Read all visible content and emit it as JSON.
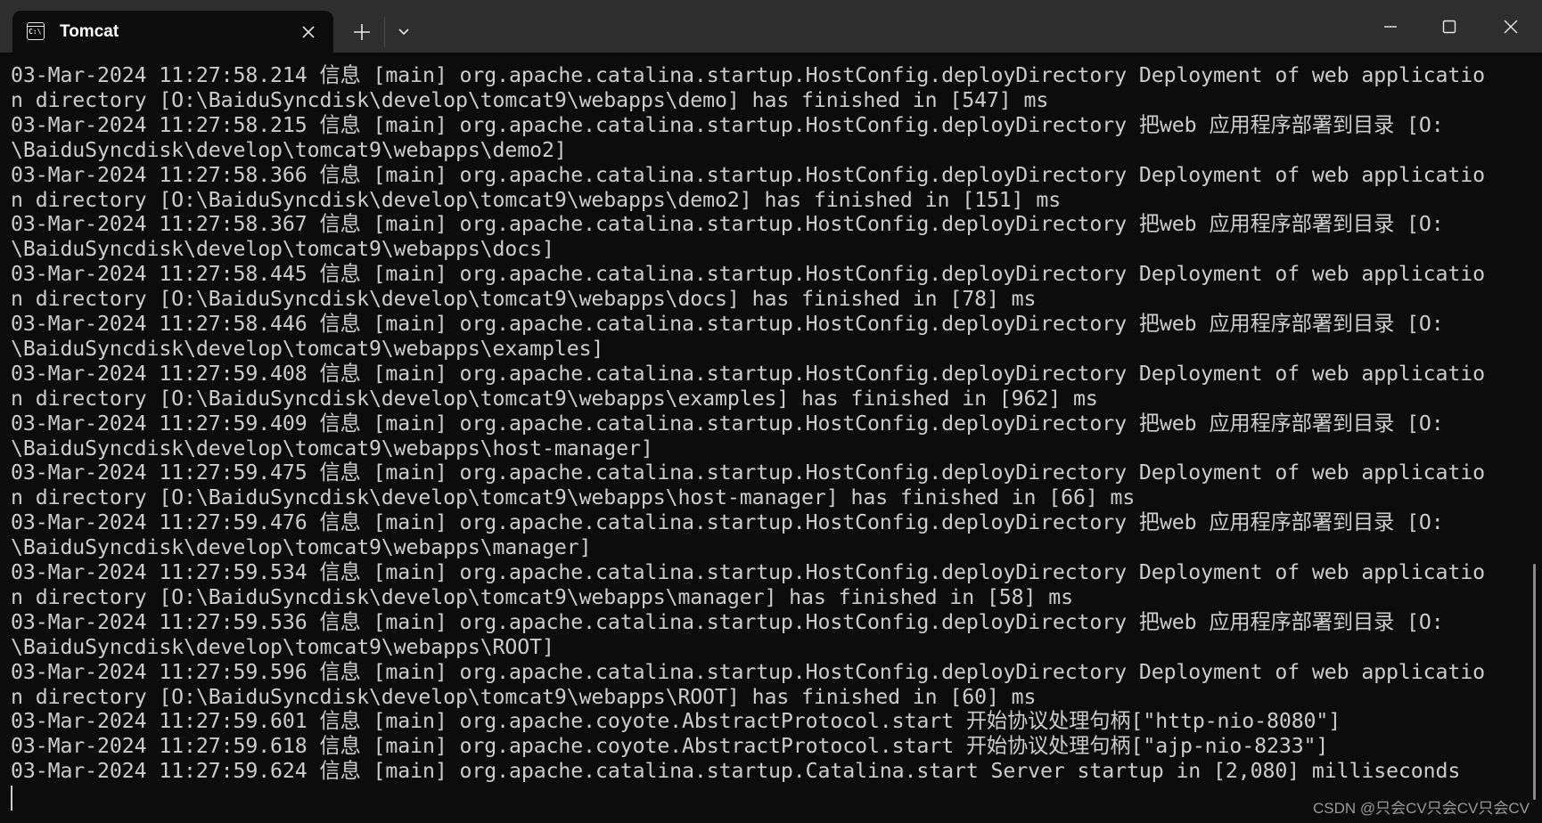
{
  "window": {
    "tab_title": "Tomcat",
    "tab_icon": "cmd-icon",
    "tab_icon_text": "C:\\",
    "new_tab_label": "+",
    "close_tab_label": "✕"
  },
  "terminal": {
    "lines": [
      "03-Mar-2024 11:27:58.214 信息 [main] org.apache.catalina.startup.HostConfig.deployDirectory Deployment of web applicatio",
      "n directory [O:\\BaiduSyncdisk\\develop\\tomcat9\\webapps\\demo] has finished in [547] ms",
      "03-Mar-2024 11:27:58.215 信息 [main] org.apache.catalina.startup.HostConfig.deployDirectory 把web 应用程序部署到目录 [O:",
      "\\BaiduSyncdisk\\develop\\tomcat9\\webapps\\demo2]",
      "03-Mar-2024 11:27:58.366 信息 [main] org.apache.catalina.startup.HostConfig.deployDirectory Deployment of web applicatio",
      "n directory [O:\\BaiduSyncdisk\\develop\\tomcat9\\webapps\\demo2] has finished in [151] ms",
      "03-Mar-2024 11:27:58.367 信息 [main] org.apache.catalina.startup.HostConfig.deployDirectory 把web 应用程序部署到目录 [O:",
      "\\BaiduSyncdisk\\develop\\tomcat9\\webapps\\docs]",
      "03-Mar-2024 11:27:58.445 信息 [main] org.apache.catalina.startup.HostConfig.deployDirectory Deployment of web applicatio",
      "n directory [O:\\BaiduSyncdisk\\develop\\tomcat9\\webapps\\docs] has finished in [78] ms",
      "03-Mar-2024 11:27:58.446 信息 [main] org.apache.catalina.startup.HostConfig.deployDirectory 把web 应用程序部署到目录 [O:",
      "\\BaiduSyncdisk\\develop\\tomcat9\\webapps\\examples]",
      "03-Mar-2024 11:27:59.408 信息 [main] org.apache.catalina.startup.HostConfig.deployDirectory Deployment of web applicatio",
      "n directory [O:\\BaiduSyncdisk\\develop\\tomcat9\\webapps\\examples] has finished in [962] ms",
      "03-Mar-2024 11:27:59.409 信息 [main] org.apache.catalina.startup.HostConfig.deployDirectory 把web 应用程序部署到目录 [O:",
      "\\BaiduSyncdisk\\develop\\tomcat9\\webapps\\host-manager]",
      "03-Mar-2024 11:27:59.475 信息 [main] org.apache.catalina.startup.HostConfig.deployDirectory Deployment of web applicatio",
      "n directory [O:\\BaiduSyncdisk\\develop\\tomcat9\\webapps\\host-manager] has finished in [66] ms",
      "03-Mar-2024 11:27:59.476 信息 [main] org.apache.catalina.startup.HostConfig.deployDirectory 把web 应用程序部署到目录 [O:",
      "\\BaiduSyncdisk\\develop\\tomcat9\\webapps\\manager]",
      "03-Mar-2024 11:27:59.534 信息 [main] org.apache.catalina.startup.HostConfig.deployDirectory Deployment of web applicatio",
      "n directory [O:\\BaiduSyncdisk\\develop\\tomcat9\\webapps\\manager] has finished in [58] ms",
      "03-Mar-2024 11:27:59.536 信息 [main] org.apache.catalina.startup.HostConfig.deployDirectory 把web 应用程序部署到目录 [O:",
      "\\BaiduSyncdisk\\develop\\tomcat9\\webapps\\ROOT]",
      "03-Mar-2024 11:27:59.596 信息 [main] org.apache.catalina.startup.HostConfig.deployDirectory Deployment of web applicatio",
      "n directory [O:\\BaiduSyncdisk\\develop\\tomcat9\\webapps\\ROOT] has finished in [60] ms",
      "03-Mar-2024 11:27:59.601 信息 [main] org.apache.coyote.AbstractProtocol.start 开始协议处理句柄[\"http-nio-8080\"]",
      "03-Mar-2024 11:27:59.618 信息 [main] org.apache.coyote.AbstractProtocol.start 开始协议处理句柄[\"ajp-nio-8233\"]",
      "03-Mar-2024 11:27:59.624 信息 [main] org.apache.catalina.startup.Catalina.start Server startup in [2,080] milliseconds"
    ]
  },
  "watermark": "CSDN @只会CV只会CV只会CV"
}
